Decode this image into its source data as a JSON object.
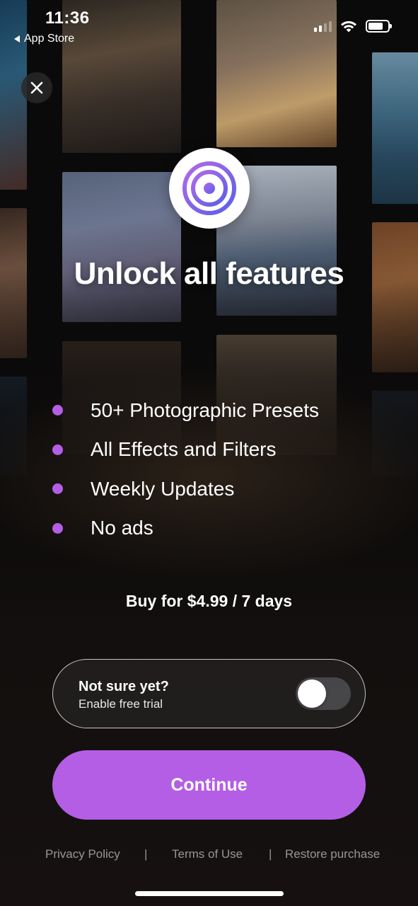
{
  "status_bar": {
    "time": "11:36",
    "back_label": "App Store"
  },
  "paywall": {
    "headline": "Unlock all features",
    "features": [
      "50+ Photographic Presets",
      "All Effects and Filters",
      "Weekly Updates",
      "No ads"
    ],
    "price_text": "Buy for $4.99 / 7 days",
    "trial": {
      "title": "Not sure yet?",
      "subtitle": "Enable free trial",
      "enabled": false
    },
    "continue_label": "Continue"
  },
  "footer": {
    "privacy": "Privacy Policy",
    "separator": "|",
    "terms": "Terms of Use",
    "restore": "Restore purchase"
  },
  "colors": {
    "accent": "#b45ee6",
    "background": "#120f0e"
  },
  "icons": [
    "close-icon",
    "app-logo-icon",
    "cellular-signal-icon",
    "wifi-icon",
    "battery-icon",
    "back-arrow-icon"
  ]
}
